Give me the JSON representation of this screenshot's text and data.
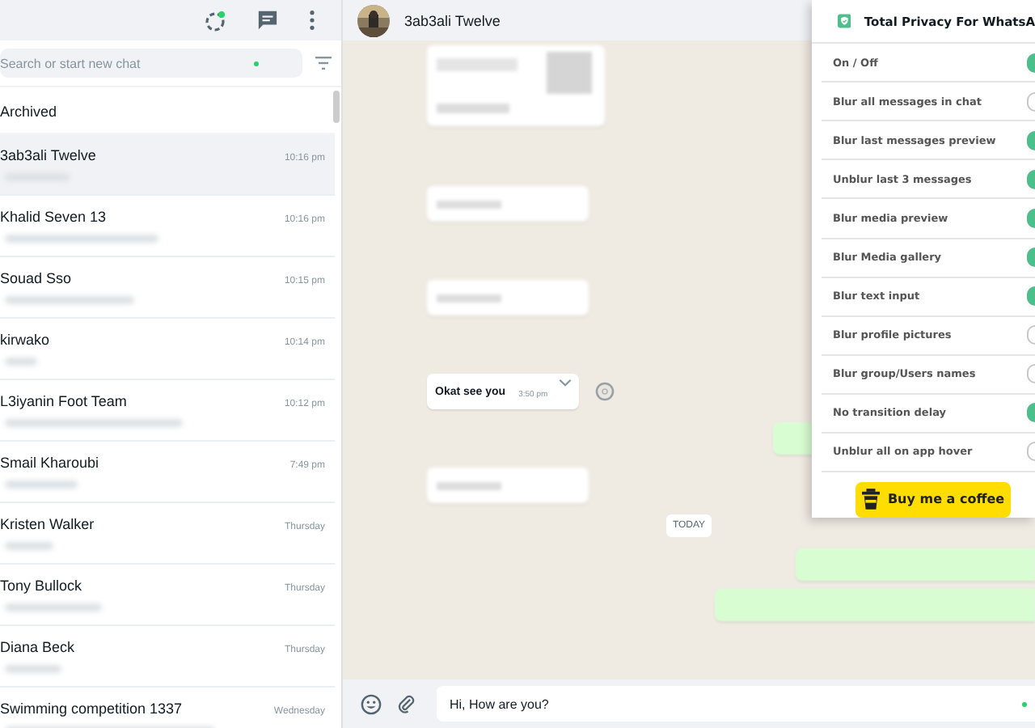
{
  "sidebar": {
    "search": {
      "placeholder": "Search or start new chat"
    },
    "archived": "Archived",
    "chats": [
      {
        "name": "3ab3ali Twelve",
        "time": "10:16 pm",
        "selected": true
      },
      {
        "name": "Khalid Seven 13",
        "time": "10:16 pm",
        "selected": false
      },
      {
        "name": "Souad Sso",
        "time": "10:15 pm",
        "selected": false
      },
      {
        "name": "kirwako",
        "time": "10:14 pm",
        "selected": false
      },
      {
        "name": "L3iyanin Foot Team",
        "time": "10:12 pm",
        "selected": false
      },
      {
        "name": "Smail Kharoubi",
        "time": "7:49 pm",
        "selected": false
      },
      {
        "name": "Kristen Walker",
        "time": "Thursday",
        "selected": false
      },
      {
        "name": "Tony Bullock",
        "time": "Thursday",
        "selected": false
      },
      {
        "name": "Diana Beck",
        "time": "Thursday",
        "selected": false
      },
      {
        "name": "Swimming competition 1337",
        "time": "Wednesday",
        "selected": false
      }
    ]
  },
  "chat": {
    "contact": "3ab3ali Twelve",
    "messages": [
      {
        "kind": "media"
      },
      {
        "kind": "blurred"
      },
      {
        "kind": "blurred"
      },
      {
        "kind": "message",
        "text": "Okat see you",
        "time": "3:50 pm"
      },
      {
        "kind": "sent"
      },
      {
        "kind": "blurred"
      },
      {
        "kind": "date",
        "text": "TODAY"
      },
      {
        "kind": "sent"
      },
      {
        "kind": "sent"
      }
    ],
    "composer": {
      "value": "Hi, How are you?"
    }
  },
  "privacy_panel": {
    "title": "Total Privacy For WhatsA",
    "options": [
      {
        "label": "On / Off",
        "on": true
      },
      {
        "label": "Blur all messages in chat",
        "on": false
      },
      {
        "label": "Blur last messages preview",
        "on": true
      },
      {
        "label": "Unblur last 3 messages",
        "on": true
      },
      {
        "label": "Blur media preview",
        "on": true
      },
      {
        "label": "Blur Media gallery",
        "on": true
      },
      {
        "label": "Blur text input",
        "on": true
      },
      {
        "label": "Blur profile pictures",
        "on": false
      },
      {
        "label": "Blur group/Users names",
        "on": false
      },
      {
        "label": "No transition delay",
        "on": true
      },
      {
        "label": "Unblur all on app hover",
        "on": false
      }
    ],
    "coffee_button": "Buy me a coffee"
  }
}
